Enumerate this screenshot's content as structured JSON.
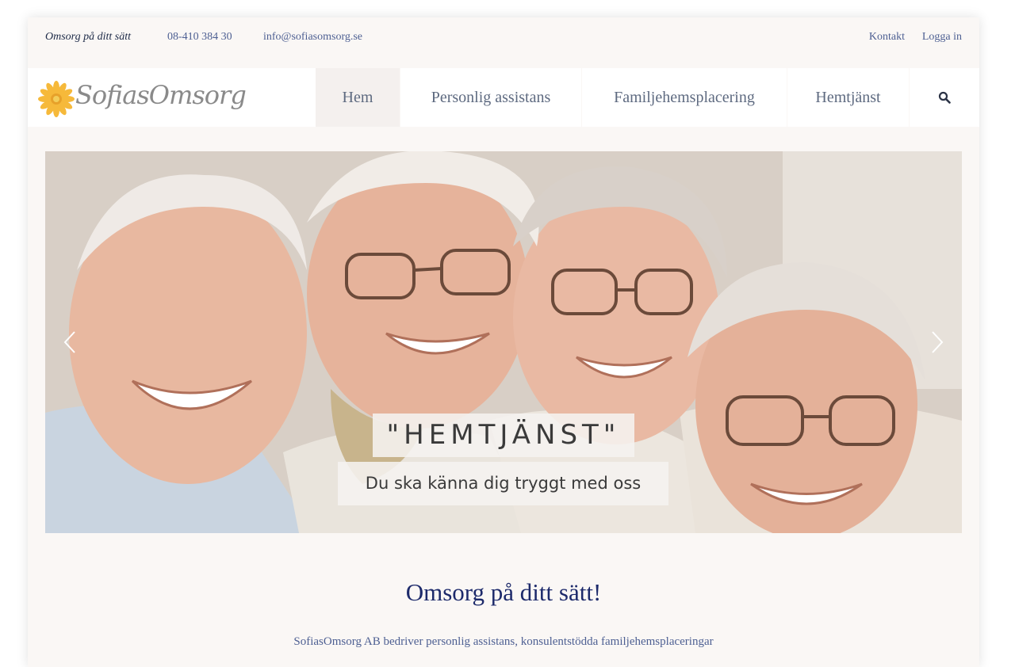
{
  "topbar": {
    "tagline": "Omsorg på ditt sätt",
    "phone": "08-410 384 30",
    "email": "info@sofiasomsorg.se",
    "contact": "Kontakt",
    "login": "Logga in"
  },
  "logo": {
    "text": "SofiasOmsorg",
    "icon": "sunflower-icon"
  },
  "nav": {
    "items": [
      {
        "label": "Hem",
        "active": true
      },
      {
        "label": "Personlig assistans"
      },
      {
        "label": "Familjehemsplacering"
      },
      {
        "label": "Hemtjänst"
      }
    ],
    "search_icon": "search-icon"
  },
  "hero": {
    "title": "\"HEMTJÄNST\"",
    "subtitle": "Du ska känna dig tryggt med oss",
    "prev_icon": "chevron-left-icon",
    "next_icon": "chevron-right-icon"
  },
  "main": {
    "heading": "Omsorg på ditt sätt!",
    "intro": "SofiasOmsorg AB bedriver personlig assistans, konsulentstödda familjehemsplaceringar"
  },
  "colors": {
    "accent": "#4d5f92",
    "heading": "#1d2a6b",
    "background": "#faf7f5"
  }
}
